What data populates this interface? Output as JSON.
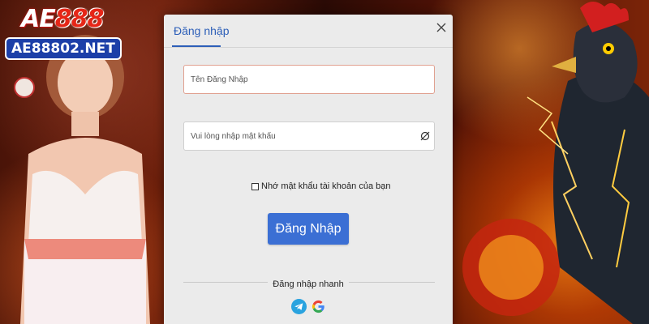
{
  "brand": {
    "logo_prefix": "AE",
    "logo_number": "888",
    "domain": "AE88802.NET"
  },
  "login_dialog": {
    "title": "Đăng nhập",
    "username_placeholder": "Tên Đăng Nhập",
    "password_placeholder": "Vui lòng nhập mật khẩu",
    "remember_label": "Nhớ mật khẩu tài khoản của bạn",
    "remember_checked": false,
    "submit_label": "Đăng Nhập",
    "quick_login_label": "Đăng nhập nhanh",
    "quick_login_options": [
      "telegram-icon",
      "google-icon"
    ]
  },
  "colors": {
    "accent": "#3b6fd4",
    "title": "#2d5fb8",
    "logo_red": "#e62617",
    "domain_badge": "#1c3fa8"
  }
}
